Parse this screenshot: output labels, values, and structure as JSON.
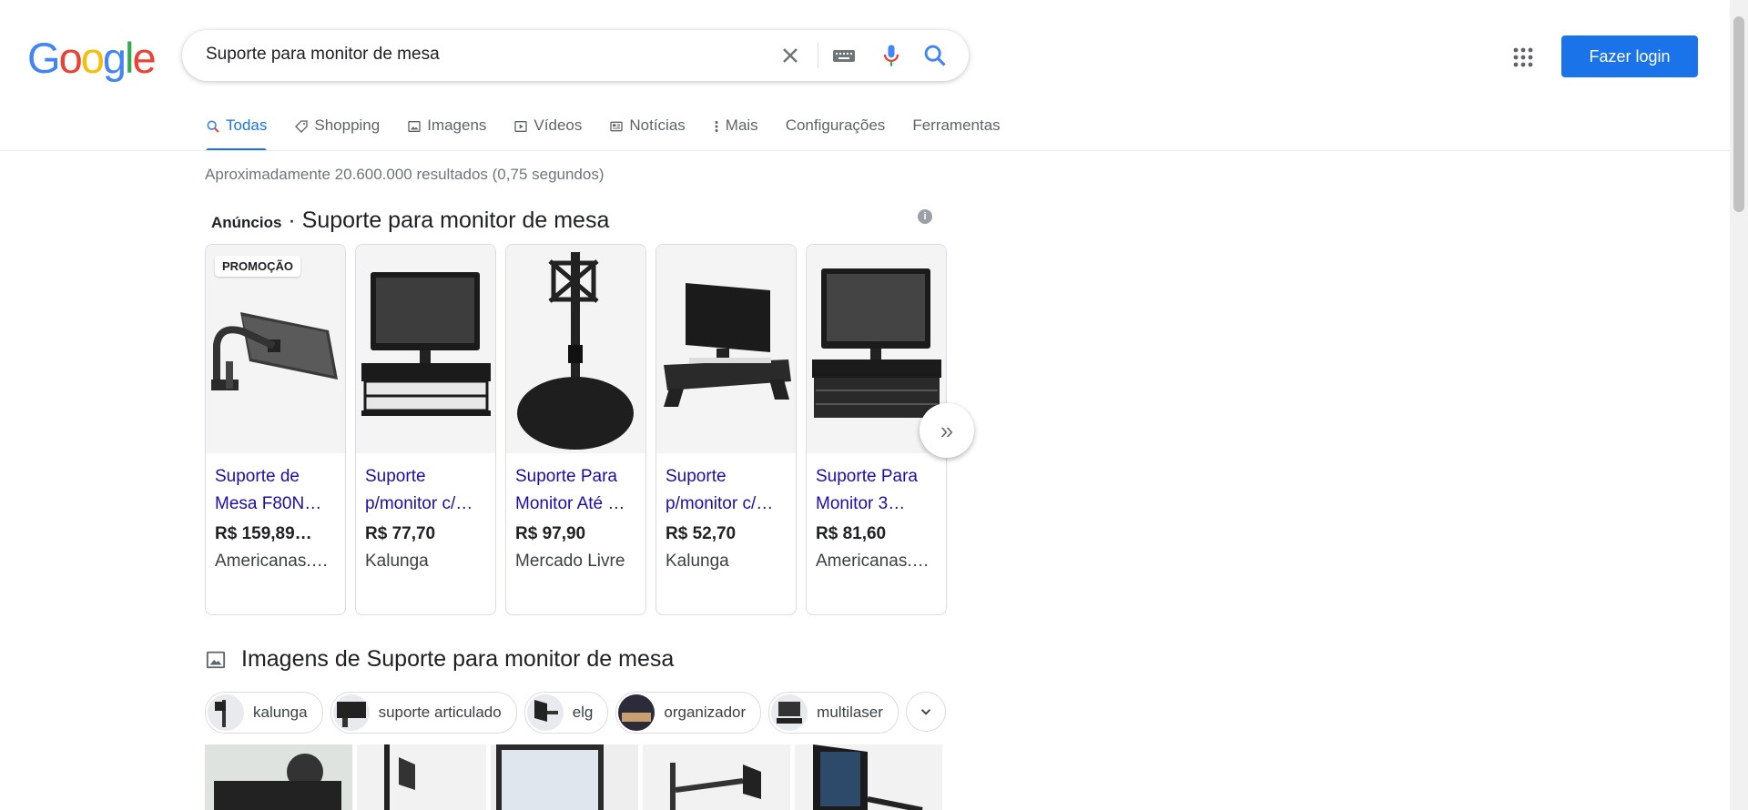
{
  "header": {
    "logo_letters": [
      "G",
      "o",
      "o",
      "g",
      "l",
      "e"
    ],
    "logo_colors": [
      "#4285f4",
      "#ea4335",
      "#fbbc05",
      "#4285f4",
      "#34a853",
      "#ea4335"
    ],
    "search_value": "Suporte para monitor de mesa",
    "login_label": "Fazer login"
  },
  "tabs": [
    {
      "label": "Todas",
      "icon": "search-icon",
      "active": true
    },
    {
      "label": "Shopping",
      "icon": "tag-icon"
    },
    {
      "label": "Imagens",
      "icon": "image-icon"
    },
    {
      "label": "Vídeos",
      "icon": "play-icon"
    },
    {
      "label": "Notícias",
      "icon": "news-icon"
    },
    {
      "label": "Mais",
      "icon": "more-vert-icon"
    },
    {
      "label": "Configurações"
    },
    {
      "label": "Ferramentas"
    }
  ],
  "result_stats": "Aproximadamente 20.600.000 resultados (0,75 segundos)",
  "ads": {
    "label": "Anúncios",
    "separator": " · ",
    "query": "Suporte para monitor de mesa",
    "info": "i",
    "promo_badge": "PROMOÇÃO",
    "next_icon": "»",
    "cards": [
      {
        "title1": "Suporte de",
        "title2": "Mesa F80N…",
        "price": "R$ 159,89…",
        "store": "Americanas.…"
      },
      {
        "title1": "Suporte",
        "title2": "p/monitor c/…",
        "price": "R$ 77,70",
        "store": "Kalunga"
      },
      {
        "title1": "Suporte Para",
        "title2": "Monitor Até …",
        "price": "R$ 97,90",
        "store": "Mercado Livre"
      },
      {
        "title1": "Suporte",
        "title2": "p/monitor c/…",
        "price": "R$ 52,70",
        "store": "Kalunga"
      },
      {
        "title1": "Suporte Para",
        "title2": "Monitor 3…",
        "price": "R$ 81,60",
        "store": "Americanas.…"
      }
    ]
  },
  "images": {
    "title": "Imagens de Suporte para monitor de mesa",
    "chips": [
      "kalunga",
      "suporte articulado",
      "elg",
      "organizador",
      "multilaser"
    ]
  }
}
